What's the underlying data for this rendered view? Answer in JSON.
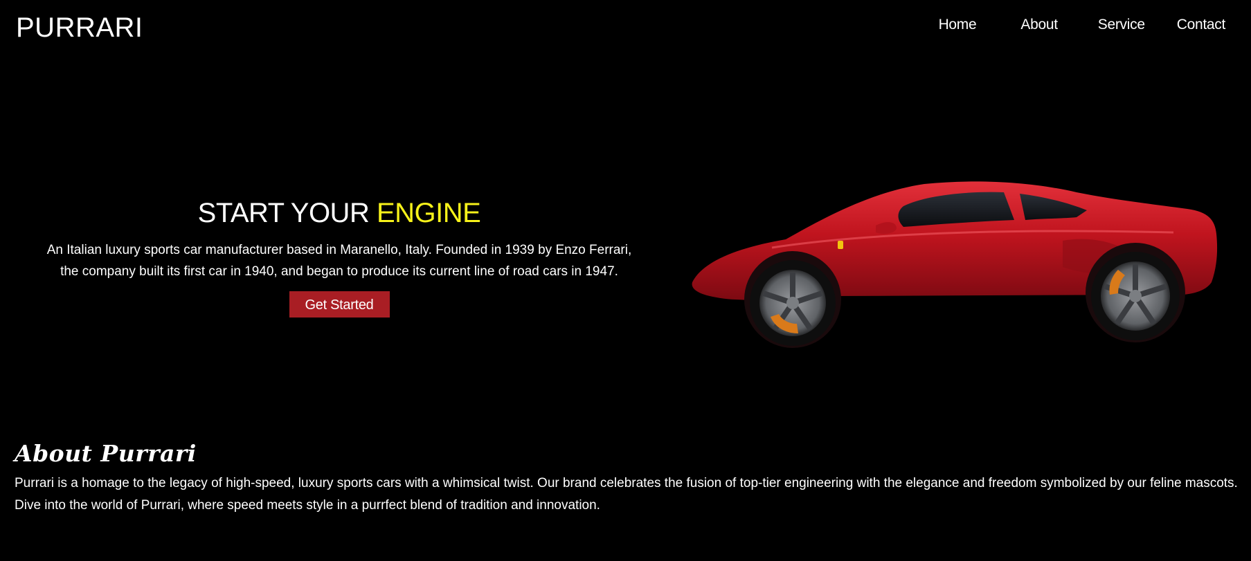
{
  "header": {
    "brand": "PURRARI",
    "nav": {
      "home": "Home",
      "about": "About",
      "service": "Service",
      "contact": "Contact"
    }
  },
  "hero": {
    "title_main": "START YOUR ",
    "title_accent": "ENGINE",
    "description": "An Italian luxury sports car manufacturer based in Maranello, Italy. Founded in 1939 by Enzo Ferrari, the company built its first car in 1940, and began to produce its current line of road cars in 1947.",
    "cta_label": "Get Started",
    "image": "red-sports-car"
  },
  "about": {
    "title": "About Purrari",
    "text": "Purrari is a homage to the legacy of high-speed, luxury sports cars with a whimsical twist. Our brand celebrates the fusion of top-tier engineering with the elegance and freedom symbolized by our feline mascots. Dive into the world of Purrari, where speed meets style in a purrfect blend of tradition and innovation."
  },
  "colors": {
    "background": "#000000",
    "text": "#ffffff",
    "accent": "#f7f21a",
    "button": "#a91e24",
    "car": "#c0141e"
  }
}
